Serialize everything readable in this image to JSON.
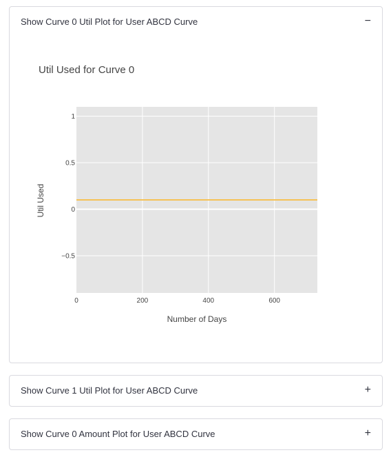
{
  "expanders": [
    {
      "title": "Show Curve 0 Util Plot for User ABCD Curve",
      "toggle": "−",
      "expanded": true
    },
    {
      "title": "Show Curve 1 Util Plot for User ABCD Curve",
      "toggle": "+",
      "expanded": false
    },
    {
      "title": "Show Curve 0 Amount Plot for User ABCD Curve",
      "toggle": "+",
      "expanded": false
    }
  ],
  "colors": {
    "plot_background": "#e5e5e5",
    "grid": "#ffffff",
    "line": "#f5c155"
  },
  "chart_data": {
    "type": "line",
    "title": "Util Used for Curve 0",
    "xlabel": "Number of Days",
    "ylabel": "Util Used",
    "xlim": [
      0,
      730
    ],
    "ylim": [
      -0.9,
      1.1
    ],
    "xticks": [
      0,
      200,
      400,
      600
    ],
    "xtick_labels": [
      "0",
      "200",
      "400",
      "600"
    ],
    "yticks": [
      1,
      0.5,
      0,
      -0.5
    ],
    "ytick_labels": [
      "1",
      "0.5",
      "0",
      "−0.5"
    ],
    "grid": true,
    "series": [
      {
        "x": [
          0,
          730
        ],
        "y": [
          0.1,
          0.1
        ]
      }
    ]
  }
}
